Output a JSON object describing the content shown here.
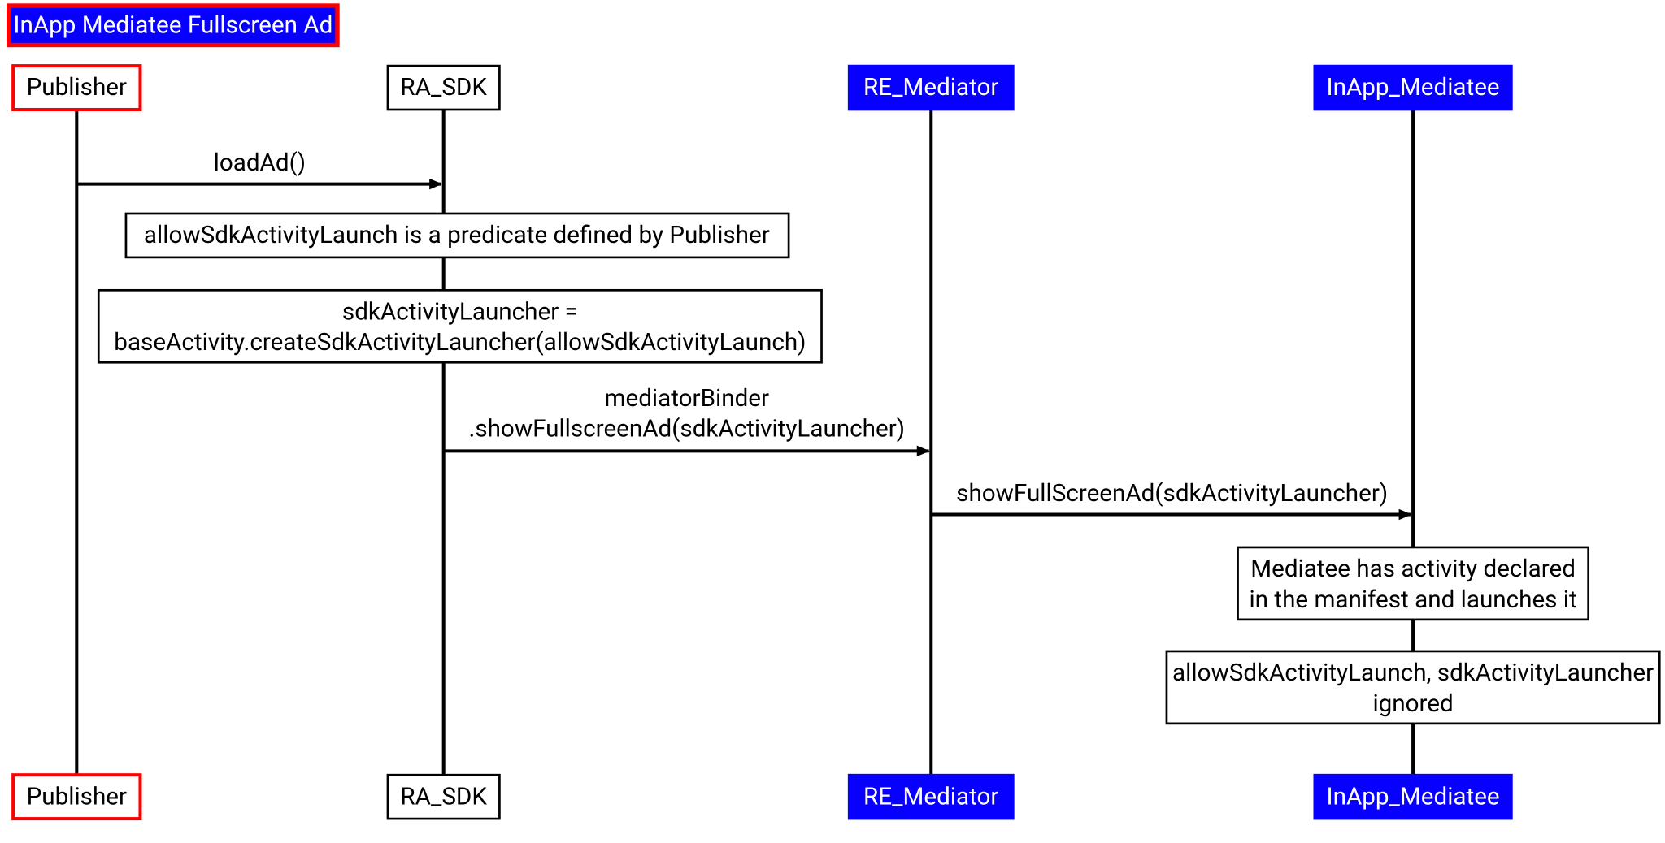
{
  "title": "InApp Mediatee Fullscreen Ad",
  "actors": {
    "publisher": "Publisher",
    "ra_sdk": "RA_SDK",
    "re_mediator": "RE_Mediator",
    "inapp_mediatee": "InApp_Mediatee"
  },
  "messages": {
    "loadAd": "loadAd()",
    "mediatorBinder_line1": "mediatorBinder",
    "mediatorBinder_line2": ".showFullscreenAd(sdkActivityLauncher)",
    "showFullScreenAd": "showFullScreenAd(sdkActivityLauncher)"
  },
  "notes": {
    "predicate": "allowSdkActivityLaunch is a predicate defined by Publisher",
    "launcher_line1": "sdkActivityLauncher =",
    "launcher_line2": "baseActivity.createSdkActivityLauncher(allowSdkActivityLaunch)",
    "mediatee_line1": "Mediatee has activity declared",
    "mediatee_line2": "in the manifest and launches it",
    "ignored_line1": "allowSdkActivityLaunch, sdkActivityLauncher",
    "ignored_line2": "ignored"
  }
}
